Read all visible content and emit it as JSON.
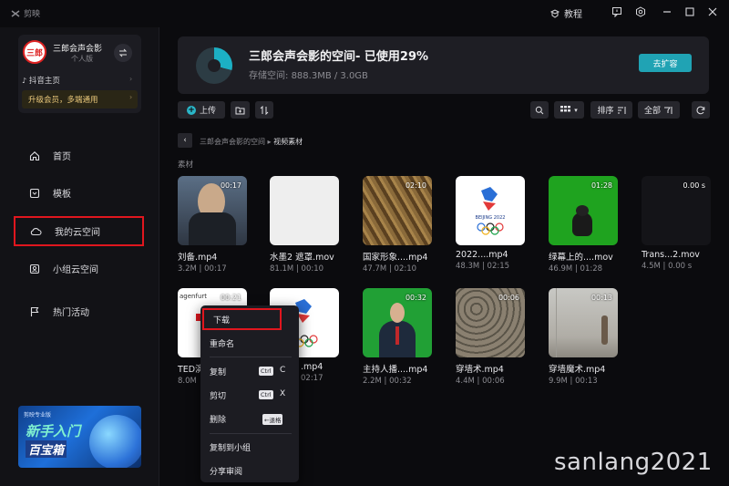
{
  "titlebar": {
    "app_logo": "剪映",
    "tutorial": "教程",
    "icons": [
      "tutorial-icon",
      "feedback-icon",
      "settings-icon",
      "minimize-icon",
      "maximize-icon",
      "close-icon"
    ]
  },
  "sidebar": {
    "user": {
      "avatar_text": "三郎",
      "name": "三郎会声会影",
      "tier": "个人版",
      "douyin": "抖音主页",
      "upgrade": "升级会员，多端通用"
    },
    "nav": [
      {
        "label": "首页",
        "icon": "home-icon"
      },
      {
        "label": "模板",
        "icon": "template-icon"
      },
      {
        "label": "我的云空间",
        "icon": "cloud-icon",
        "active": true
      },
      {
        "label": "小组云空间",
        "icon": "group-icon"
      },
      {
        "label": "热门活动",
        "icon": "flag-icon"
      }
    ],
    "promo": {
      "tag": "剪映专业版",
      "line1": "新手入门",
      "line2": "百宝箱"
    }
  },
  "storage": {
    "title": "三郎会声会影的空间- 已使用29%",
    "used_percent": 29,
    "sub_label": "存储空间:",
    "sub_value": "888.3MB / 3.0GB",
    "expand_button": "去扩容",
    "accent": "#1cb0c4"
  },
  "toolbar": {
    "upload": "上传",
    "sort": "排序",
    "filter": "全部"
  },
  "breadcrumb": {
    "parent": "三郎会声会影的空间",
    "sep": "▸",
    "current": "视频素材"
  },
  "section_label": "素材",
  "files_row1": [
    {
      "name": "刘备.mp4",
      "size": "3.2M",
      "duration": "00:17",
      "badge": "00:17"
    },
    {
      "name": "水墨2 遮罩.mov",
      "size": "81.1M",
      "duration": "00:10",
      "badge": ""
    },
    {
      "name": "国家形象....mp4",
      "size": "47.7M",
      "duration": "02:10",
      "badge": "02:10"
    },
    {
      "name": "2022....mp4",
      "size": "48.3M",
      "duration": "02:15",
      "badge": ""
    },
    {
      "name": "绿幕上的....mov",
      "size": "46.9M",
      "duration": "01:28",
      "badge": "01:28"
    },
    {
      "name": "Trans...2.mov",
      "size": "4.5M",
      "duration": "0.00 s",
      "badge": "0.00 s"
    }
  ],
  "files_row2": [
    {
      "name": "TED演",
      "size": "8.0M",
      "duration": "",
      "badge": "00:21",
      "thumb_text": "agenfurt"
    },
    {
      "name": ".mp4",
      "size": "",
      "duration": "02:17",
      "badge": ""
    },
    {
      "name": "主持人播....mp4",
      "size": "2.2M",
      "duration": "00:32",
      "badge": "00:32"
    },
    {
      "name": "穿墙术.mp4",
      "size": "4.4M",
      "duration": "00:06",
      "badge": "00:06"
    },
    {
      "name": "穿墙魔术.mp4",
      "size": "9.9M",
      "duration": "00:13",
      "badge": "00:13"
    }
  ],
  "meta_sep": " | ",
  "context_menu": {
    "download": "下载",
    "rename": "重命名",
    "copy": "复制",
    "copy_key_mod": "Ctrl",
    "copy_key": "C",
    "cut": "剪切",
    "cut_key_mod": "Ctrl",
    "cut_key": "X",
    "delete": "删除",
    "delete_key": "←退格",
    "copy_to_group": "复制到小组",
    "share_review": "分享审阅"
  },
  "watermark": "sanlang2021"
}
